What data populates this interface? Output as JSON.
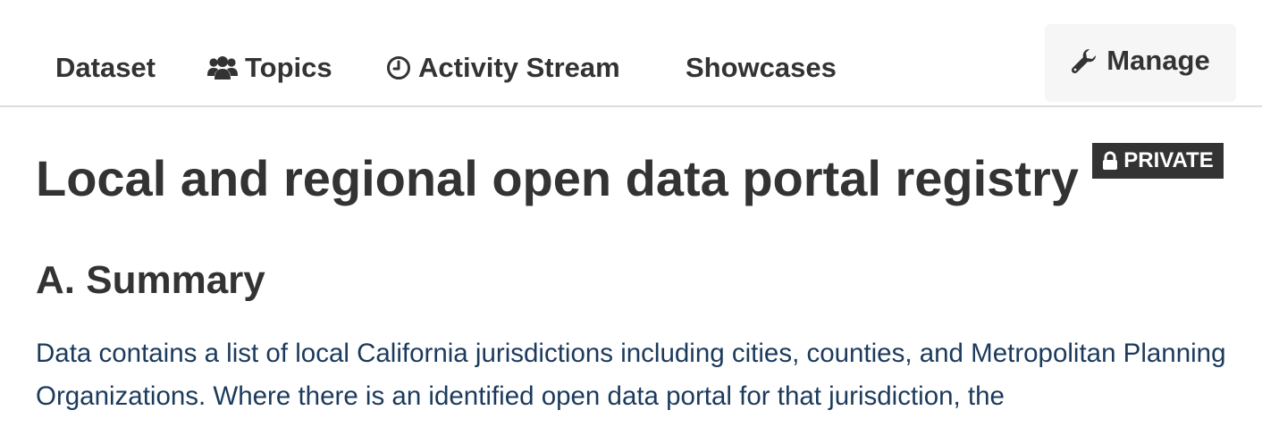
{
  "tabs": {
    "dataset": {
      "label": "Dataset"
    },
    "topics": {
      "label": "Topics",
      "icon": "users-icon"
    },
    "activity": {
      "label": "Activity Stream",
      "icon": "clock-icon"
    },
    "showcases": {
      "label": "Showcases"
    }
  },
  "manage": {
    "label": "Manage",
    "icon": "wrench-icon"
  },
  "dataset": {
    "title": "Local and regional open data portal registry",
    "badge": {
      "label": "PRIVATE",
      "icon": "lock-icon"
    }
  },
  "summary": {
    "heading": "A. Summary",
    "text": "Data contains a list of local California jurisdictions including cities, counties, and Metropolitan Planning Organizations. Where there is an identified open data portal for that jurisdiction, the"
  },
  "colors": {
    "text": "#333333",
    "summary_text": "#1b3a5c",
    "manage_bg": "#f6f6f6",
    "badge_bg": "#333333",
    "divider": "#dddddd"
  }
}
